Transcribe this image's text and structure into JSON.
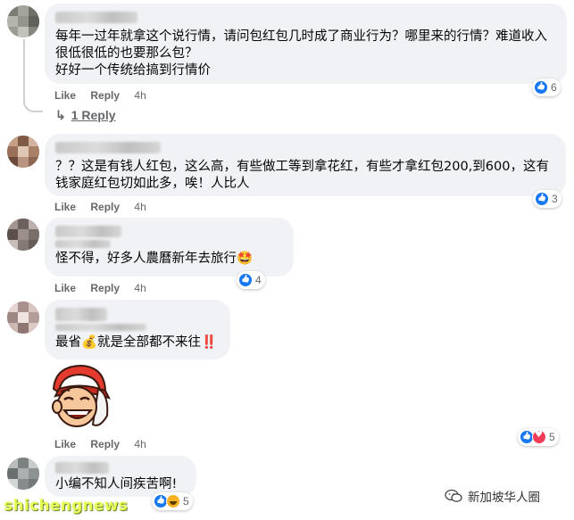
{
  "comments": [
    {
      "text": "每年一过年就拿这个说行情，请问包红包几时成了商业行为？哪里来的行情？难道收入很低很低的也要那么包？\n好好一个传统给搞到行情价",
      "actions": {
        "like": "Like",
        "reply": "Reply",
        "time": "4h"
      },
      "reaction_count": "6",
      "reactions": [
        "like-icon"
      ],
      "replies_label": "1 Reply"
    },
    {
      "text": "？？这是有钱人红包，这么高，有些做工等到拿花红，有些才拿红包200,到600，这有钱家庭红包切如此多，唉！人比人",
      "actions": {
        "like": "Like",
        "reply": "Reply",
        "time": "4h"
      },
      "reaction_count": "3",
      "reactions": [
        "like-icon"
      ]
    },
    {
      "text": "怪不得，好多人農曆新年去旅行🤩",
      "actions": {
        "like": "Like",
        "reply": "Reply",
        "time": "4h"
      },
      "reaction_count": "4",
      "reactions": [
        "like-icon"
      ]
    },
    {
      "text": "最省💰就是全部都不来往‼️",
      "actions": {
        "like": "Like",
        "reply": "Reply",
        "time": "4h"
      },
      "reaction_count": "5",
      "reactions": [
        "like-icon",
        "love-icon"
      ],
      "sticker": "laughing-man-sticker"
    },
    {
      "text": "小编不知人间疾苦啊!",
      "reaction_count": "5",
      "reactions": [
        "like-icon",
        "haha-icon"
      ]
    }
  ],
  "watermarks": {
    "left": "shichengnews",
    "right": "新加坡华人圈"
  },
  "colors": {
    "bubble": "#f0f2f5",
    "action_text": "#65676b",
    "like_blue": "#1877f2",
    "love_red": "#f33e58",
    "haha_yellow": "#f7b125"
  }
}
